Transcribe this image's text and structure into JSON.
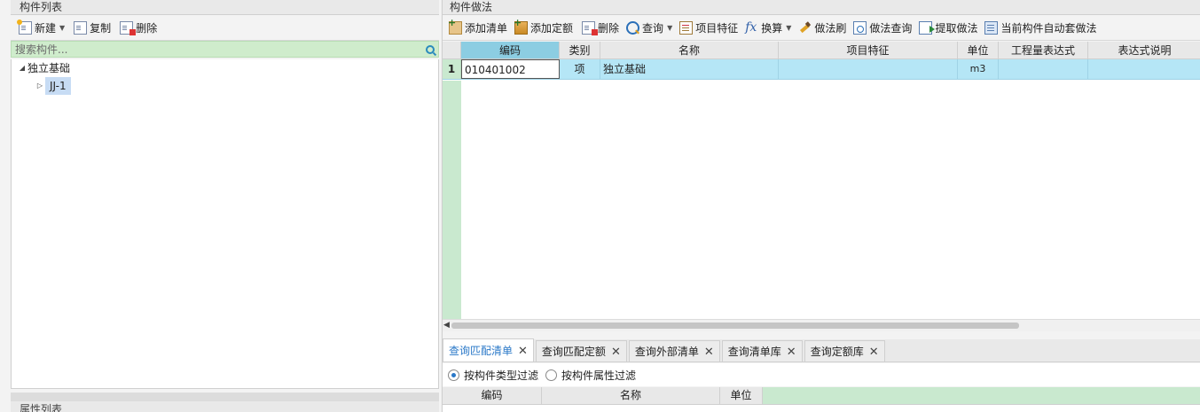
{
  "left": {
    "title": "构件列表",
    "toolbar": {
      "new_label": "新建",
      "copy_label": "复制",
      "delete_label": "删除"
    },
    "search": {
      "placeholder": "搜索构件..."
    },
    "tree": {
      "root": "独立基础",
      "child": "JJ-1"
    },
    "bottom_title": "属性列表"
  },
  "right": {
    "title": "构件做法",
    "toolbar": {
      "add_list": "添加清单",
      "add_quota": "添加定额",
      "delete": "删除",
      "query": "查询",
      "item_feature": "项目特征",
      "convert": "换算",
      "method_brush": "做法刷",
      "method_query": "做法查询",
      "extract_method": "提取做法",
      "auto_method": "当前构件自动套做法"
    },
    "grid": {
      "columns": [
        "编码",
        "类别",
        "名称",
        "项目特征",
        "单位",
        "工程量表达式",
        "表达式说明"
      ],
      "rows": [
        {
          "num": "1",
          "code": "010401002",
          "type": "项",
          "name": "独立基础",
          "feature": "",
          "unit": "m3",
          "expr": "",
          "expr_desc": ""
        }
      ]
    },
    "tabs": [
      "查询匹配清单",
      "查询匹配定额",
      "查询外部清单",
      "查询清单库",
      "查询定额库"
    ],
    "filters": {
      "by_type": "按构件类型过滤",
      "by_attr": "按构件属性过滤"
    },
    "bottom_grid": {
      "columns": [
        "编码",
        "名称",
        "单位"
      ]
    }
  },
  "colors": {
    "accent": "#2a78c8",
    "selected_row": "#b5e6f6",
    "search_bg": "#cfeccc",
    "code_header": "#8ccde2"
  }
}
